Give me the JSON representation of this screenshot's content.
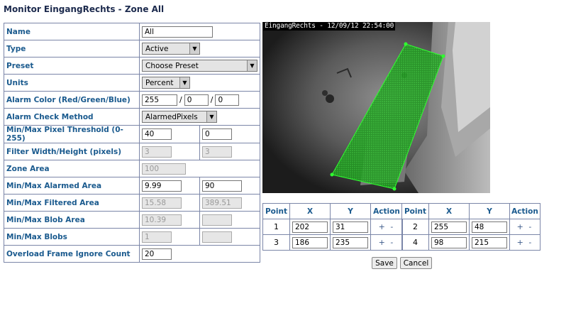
{
  "page": {
    "title": "Monitor EingangRechts - Zone All"
  },
  "fields": {
    "name": {
      "label": "Name",
      "value": "All"
    },
    "type": {
      "label": "Type",
      "value": "Active"
    },
    "preset": {
      "label": "Preset",
      "value": "Choose Preset"
    },
    "units": {
      "label": "Units",
      "value": "Percent"
    },
    "alarm_color": {
      "label": "Alarm Color (Red/Green/Blue)",
      "red": "255",
      "green": "0",
      "blue": "0",
      "sep": "/"
    },
    "alarm_check": {
      "label": "Alarm Check Method",
      "value": "AlarmedPixels"
    },
    "pixel_threshold": {
      "label": "Min/Max Pixel Threshold (0-255)",
      "min": "40",
      "max": "0"
    },
    "filter_size": {
      "label": "Filter Width/Height (pixels)",
      "width": "3",
      "height": "3"
    },
    "zone_area": {
      "label": "Zone Area",
      "value": "100"
    },
    "alarmed_area": {
      "label": "Min/Max Alarmed Area",
      "min": "9.99",
      "max": "90"
    },
    "filtered_area": {
      "label": "Min/Max Filtered Area",
      "min": "15.58",
      "max": "389.51"
    },
    "blob_area": {
      "label": "Min/Max Blob Area",
      "min": "10.39",
      "max": ""
    },
    "blobs": {
      "label": "Min/Max Blobs",
      "min": "1",
      "max": ""
    },
    "overload": {
      "label": "Overload Frame Ignore Count",
      "value": "20"
    }
  },
  "camera": {
    "overlay_text": "EingangRechts - 12/09/12 22:54:00",
    "zone_color": "#22c522"
  },
  "points_table": {
    "headers": {
      "point": "Point",
      "x": "X",
      "y": "Y",
      "action": "Action"
    },
    "action_symbols": "+ -",
    "points": [
      {
        "point": "1",
        "x": "202",
        "y": "31"
      },
      {
        "point": "2",
        "x": "255",
        "y": "48"
      },
      {
        "point": "3",
        "x": "186",
        "y": "235"
      },
      {
        "point": "4",
        "x": "98",
        "y": "215"
      }
    ]
  },
  "buttons": {
    "save": "Save",
    "cancel": "Cancel"
  }
}
